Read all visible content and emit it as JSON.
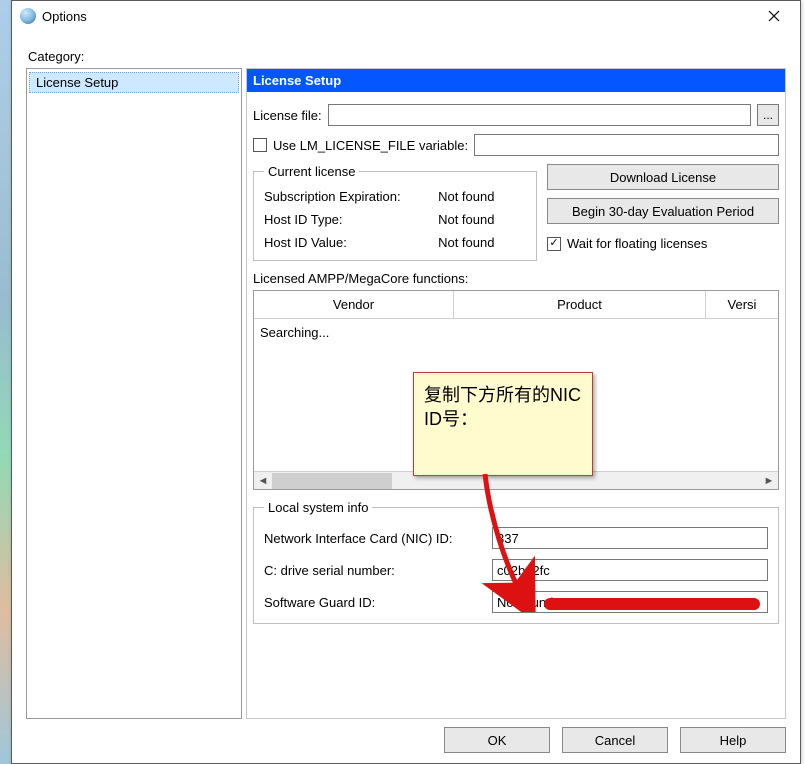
{
  "window": {
    "title": "Options",
    "category_label": "Category:"
  },
  "tree": {
    "items": [
      "License Setup"
    ]
  },
  "panel": {
    "title": "License Setup",
    "license_file_label": "License file:",
    "license_file_value": "",
    "browse_label": "...",
    "use_lm_label": "Use LM_LICENSE_FILE variable:",
    "use_lm_checked": false,
    "lm_value": ""
  },
  "current_license": {
    "legend": "Current license",
    "rows": [
      {
        "label": "Subscription Expiration:",
        "value": "Not found"
      },
      {
        "label": "Host ID Type:",
        "value": "Not found"
      },
      {
        "label": "Host ID Value:",
        "value": "Not found"
      }
    ]
  },
  "side": {
    "download": "Download License",
    "begin_eval": "Begin 30-day Evaluation Period",
    "wait_label": "Wait for floating licenses",
    "wait_checked": true
  },
  "ampp": {
    "label": "Licensed AMPP/MegaCore functions:",
    "headers": {
      "vendor": "Vendor",
      "product": "Product",
      "versi": "Versi"
    },
    "status": "Searching..."
  },
  "local": {
    "legend": "Local system info",
    "nic_label": "Network Interface Card (NIC) ID:",
    "nic_value": "337",
    "cdrive_label": "C: drive serial number:",
    "cdrive_value": "c02ba2fc",
    "sg_label": "Software Guard ID:",
    "sg_value": "Not found"
  },
  "buttons": {
    "ok": "OK",
    "cancel": "Cancel",
    "help": "Help"
  },
  "callout": {
    "text": "复制下方所有的NIC ID号："
  }
}
